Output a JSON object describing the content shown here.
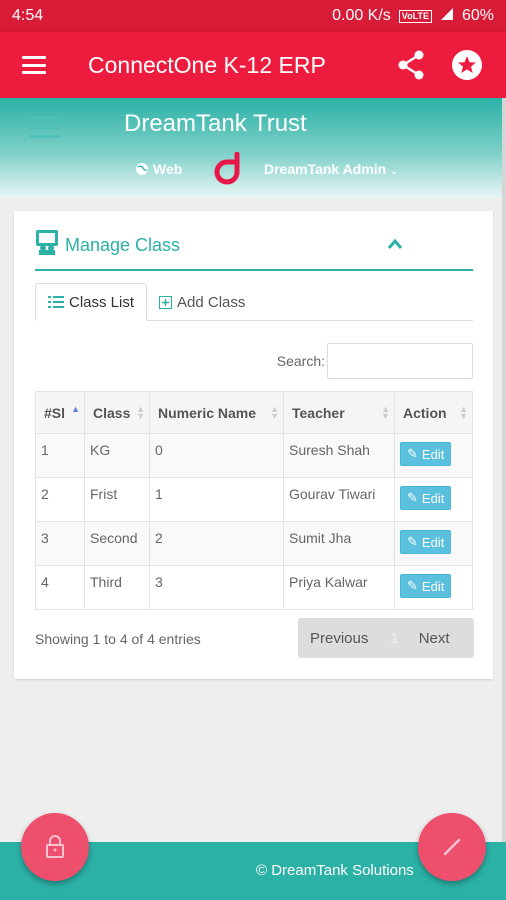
{
  "status_bar": {
    "time": "4:54",
    "speed": "0.00 K/s",
    "volte": "VoLTE",
    "battery": "60%"
  },
  "app_bar": {
    "title": "ConnectOne K-12 ERP",
    "icons": [
      "menu-icon",
      "share-icon",
      "star-icon"
    ]
  },
  "hero": {
    "org": "DreamTank Trust",
    "web": "Web",
    "admin": "DreamTank Admin"
  },
  "card": {
    "title": "Manage Class",
    "tabs": [
      {
        "label": "Class List"
      },
      {
        "label": "Add Class"
      }
    ],
    "search_label": "Search:",
    "search_value": "",
    "columns": [
      "#Sl",
      "Class",
      "Numeric Name",
      "Teacher",
      "Action"
    ],
    "rows": [
      {
        "sl": "1",
        "cls": "KG",
        "num": "0",
        "teacher": "Suresh Shah",
        "action": "Edit"
      },
      {
        "sl": "2",
        "cls": "Frist",
        "num": "1",
        "teacher": "Gourav Tiwari",
        "action": "Edit"
      },
      {
        "sl": "3",
        "cls": "Second",
        "num": "2",
        "teacher": "Sumit Jha",
        "action": "Edit"
      },
      {
        "sl": "4",
        "cls": "Third",
        "num": "3",
        "teacher": "Priya Kalwar",
        "action": "Edit"
      }
    ],
    "info": "Showing 1 to 4 of 4 entries",
    "pager": {
      "prev": "Previous",
      "page": "1",
      "next": "Next"
    }
  },
  "footer": {
    "copyright": "© DreamTank Solutions"
  },
  "colors": {
    "primary": "#ed1c3e",
    "teal": "#2bb1a6",
    "fab": "#ee4f6c",
    "info_button": "#5bc0de"
  }
}
